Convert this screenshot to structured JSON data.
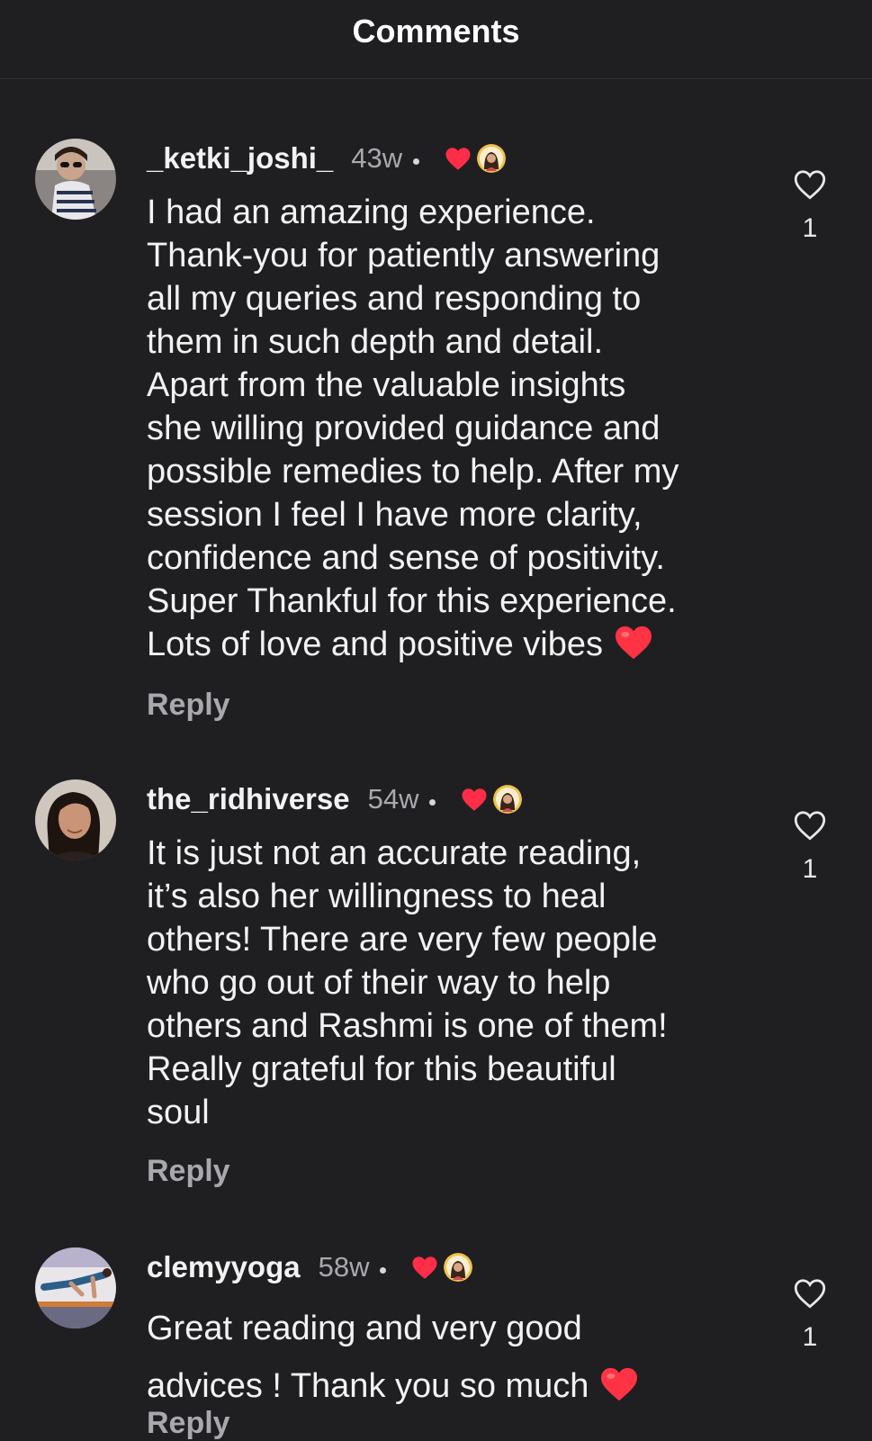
{
  "header": {
    "title": "Comments"
  },
  "comments": [
    {
      "username": "_ketki_joshi_",
      "time": "43w",
      "text_lines": [
        "I had an amazing experience.",
        "Thank-you for patiently answering",
        "all my queries and responding to",
        "them in such depth and detail.",
        "Apart from the valuable insights",
        "she willing  provided guidance and",
        "possible remedies to help. After my",
        "session I feel I have more clarity,",
        "confidence and sense of positivity.",
        "Super Thankful for this experience.",
        "Lots of love and positive vibes"
      ],
      "emoji": "heart-emoji",
      "reply_label": "Reply",
      "like_count": "1"
    },
    {
      "username": "the_ridhiverse",
      "time": "54w",
      "text_lines": [
        "It is just not an accurate reading,",
        "it’s also her willingness to heal",
        "others! There are very few people",
        "who go out of their way to help",
        "others and Rashmi is one of them!",
        "Really grateful for this beautiful",
        "soul"
      ],
      "reply_label": "Reply",
      "like_count": "1"
    },
    {
      "username": "clemyyoga",
      "time": "58w",
      "text_lines": [
        "Great reading and very good",
        "advices ! Thank you so much"
      ],
      "emoji": "heart-emoji",
      "reply_label": "Reply",
      "like_count": "1"
    }
  ],
  "colors": {
    "background": "#1f1f22",
    "text": "#f2f2f2",
    "muted": "#a8a8ae",
    "liked_heart": "#ff2d48"
  }
}
